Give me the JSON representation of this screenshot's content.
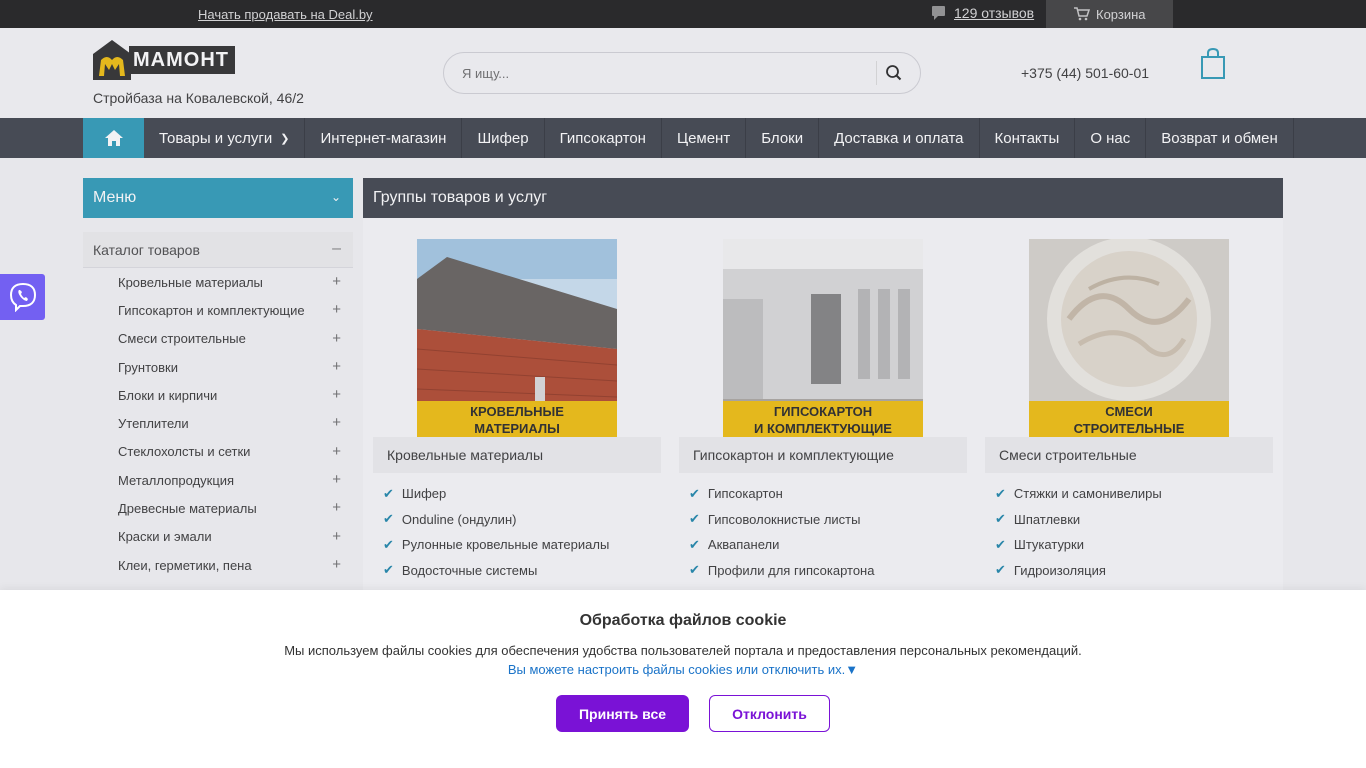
{
  "topbar": {
    "sell_link": "Начать продавать на Deal.by",
    "reviews": "129 отзывов",
    "cart": "Корзина"
  },
  "header": {
    "logo_text": "МАМОНТ",
    "subtitle": "Стройбаза на Ковалевской, 46/2",
    "search_placeholder": "Я ищу...",
    "phone": "+375 (44) 501-60-01"
  },
  "nav": {
    "items": [
      {
        "label": "Товары и услуги",
        "has_dropdown": true
      },
      {
        "label": "Интернет-магазин"
      },
      {
        "label": "Шифер"
      },
      {
        "label": "Гипсокартон"
      },
      {
        "label": "Цемент"
      },
      {
        "label": "Блоки"
      },
      {
        "label": "Доставка и оплата"
      },
      {
        "label": "Контакты"
      },
      {
        "label": "О нас"
      },
      {
        "label": "Возврат и обмен"
      }
    ]
  },
  "sidebar": {
    "menu_label": "Меню",
    "catalog_label": "Каталог товаров",
    "items": [
      "Кровельные материалы",
      "Гипсокартон и комплектующие",
      "Смеси строительные",
      "Грунтовки",
      "Блоки и кирпичи",
      "Утеплители",
      "Стеклохолсты и сетки",
      "Металлопродукция",
      "Древесные материалы",
      "Краски и эмали",
      "Клеи, герметики, пена"
    ]
  },
  "main": {
    "heading": "Группы товаров и услуг",
    "cards": [
      {
        "image_caption_1": "КРОВЕЛЬНЫЕ",
        "image_caption_2": "МАТЕРИАЛЫ",
        "title": "Кровельные материалы",
        "items": [
          "Шифер",
          "Onduline (ондулин)",
          "Рулонные кровельные материалы",
          "Водосточные системы"
        ]
      },
      {
        "image_caption_1": "ГИПСОКАРТОН",
        "image_caption_2": "И КОМПЛЕКТУЮЩИЕ",
        "title": "Гипсокартон и комплектующие",
        "items": [
          "Гипсокартон",
          "Гипсоволокнистые листы",
          "Аквапанели",
          "Профили для гипсокартона"
        ]
      },
      {
        "image_caption_1": "СМЕСИ",
        "image_caption_2": "СТРОИТЕЛЬНЫЕ",
        "title": "Смеси строительные",
        "items": [
          "Стяжки и самонивелиры",
          "Шпатлевки",
          "Штукатурки",
          "Гидроизоляция"
        ]
      }
    ]
  },
  "cookie": {
    "title": "Обработка файлов cookie",
    "text": "Мы используем файлы cookies для обеспечения удобства пользователей портала и предоставления персональных рекомендаций.",
    "settings_link": "Вы можете настроить файлы cookies или отключить их.▼",
    "accept": "Принять все",
    "decline": "Отклонить"
  },
  "colors": {
    "accent_teal": "#3aa1bd",
    "nav_dark": "#4a4e57",
    "cookie_purple": "#7a12d6",
    "viber": "#7360f2",
    "banner_yellow": "#f1c21b"
  }
}
